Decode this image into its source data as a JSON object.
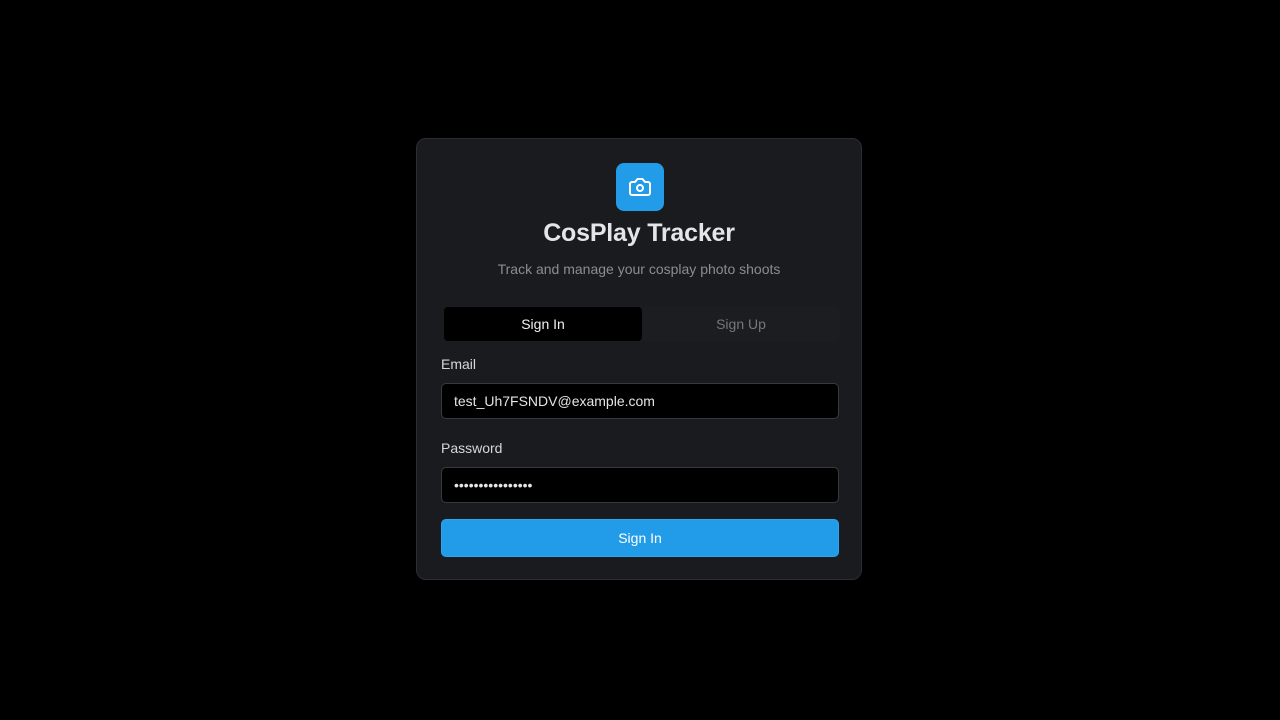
{
  "app": {
    "title": "CosPlay Tracker",
    "subtitle": "Track and manage your cosplay photo shoots",
    "logo_icon": "camera-icon",
    "accent_color": "#229ce8"
  },
  "tabs": [
    {
      "label": "Sign In",
      "active": true
    },
    {
      "label": "Sign Up",
      "active": false
    }
  ],
  "form": {
    "email_label": "Email",
    "email_value": "test_Uh7FSNDV@example.com",
    "password_label": "Password",
    "password_value": "testpassword1234",
    "submit_label": "Sign In"
  }
}
